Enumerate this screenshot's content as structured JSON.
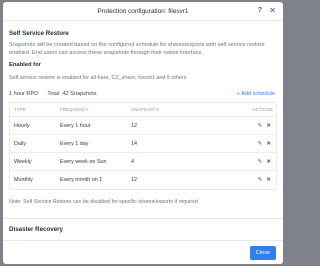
{
  "dialog": {
    "title": "Protection configuration: filesvr1",
    "help_icon": "?",
    "close_icon": "✕"
  },
  "self_service": {
    "title": "Self Service Restore",
    "description": "Snapshots will be created based on the configured schedule for shares/exports with self service restore enabled. End users can access these snapshots through their native interface.",
    "enabled_for_title": "Enabled for",
    "enabled_for_text": "Self service restore is enabled for all-hare, CZ_share, foroot1 and 5 others",
    "rpo": "1 hour RPO",
    "separator": "·",
    "total": "Total: 42 Snapshots",
    "add_schedule": "+ Add schedule"
  },
  "table": {
    "headers": {
      "type": "TYPE",
      "frequency": "FREQUENCY",
      "snapshots": "SNAPSHOTS",
      "actions": "ACTIONS"
    },
    "rows": [
      {
        "type": "Hourly",
        "frequency": "Every 1  hour",
        "snapshots": "12"
      },
      {
        "type": "Daily",
        "frequency": "Every 1  day",
        "snapshots": "14"
      },
      {
        "type": "Weekly",
        "frequency": "Every week on Sun",
        "snapshots": "4"
      },
      {
        "type": "Monthly",
        "frequency": "Every month on 1",
        "snapshots": "12"
      }
    ],
    "edit_icon": "✎",
    "delete_icon": "✕"
  },
  "note": "Note: Self Service Restore can be disabled for specific shares/exports if required",
  "disaster_recovery": {
    "title": "Disaster Recovery"
  },
  "footer": {
    "close_label": "Close"
  },
  "colors": {
    "accent": "#2f80ed",
    "overlay": "#7f8389"
  }
}
